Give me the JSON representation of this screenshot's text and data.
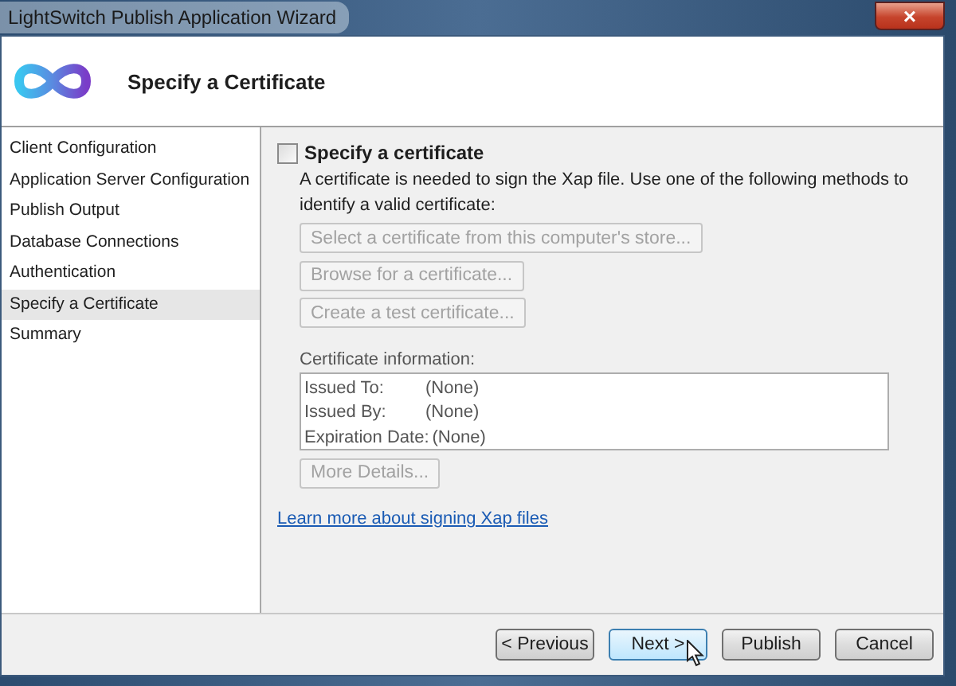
{
  "window": {
    "title": "LightSwitch Publish Application Wizard",
    "close": "×"
  },
  "header": {
    "title": "Specify a Certificate"
  },
  "sidebar": {
    "items": [
      {
        "label": "Client Configuration",
        "selected": false
      },
      {
        "label": "Application Server Configuration",
        "selected": false
      },
      {
        "label": "Publish Output",
        "selected": false
      },
      {
        "label": "Database Connections",
        "selected": false
      },
      {
        "label": "Authentication",
        "selected": false
      },
      {
        "label": "Specify a Certificate",
        "selected": true
      },
      {
        "label": "Summary",
        "selected": false
      }
    ]
  },
  "content": {
    "checkbox": {
      "label": "Specify a certificate",
      "checked": false
    },
    "description": "A certificate is needed to sign the Xap file. Use one of the following methods to identify a valid certificate:",
    "methods": [
      {
        "label": "Select a certificate from this computer's store...",
        "disabled": true
      },
      {
        "label": "Browse for a certificate...",
        "disabled": true
      },
      {
        "label": "Create a test certificate...",
        "disabled": true
      }
    ],
    "info_label": "Certificate information:",
    "info": [
      {
        "name": "Issued To:",
        "value": "(None)"
      },
      {
        "name": "Issued By:",
        "value": "(None)"
      },
      {
        "name": "Expiration Date:",
        "value": "(None)"
      }
    ],
    "more_details": {
      "label": "More Details...",
      "disabled": true
    },
    "link": "Learn more about signing Xap files"
  },
  "footer": {
    "buttons": [
      {
        "label": "< Previous",
        "focused": false
      },
      {
        "label": "Next >",
        "focused": true
      },
      {
        "label": "Publish",
        "focused": false
      },
      {
        "label": "Cancel",
        "focused": false
      }
    ]
  }
}
